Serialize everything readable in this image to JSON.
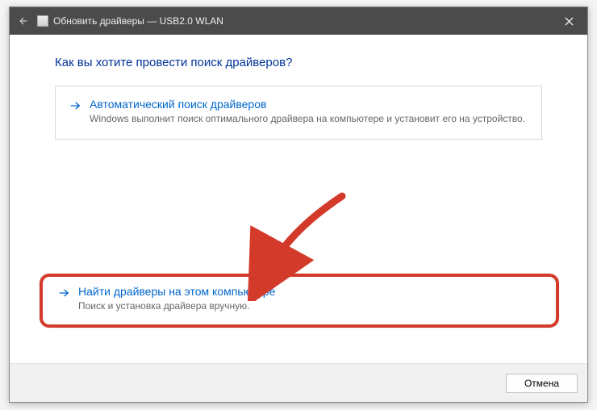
{
  "titlebar": {
    "text": "Обновить драйверы — USB2.0 WLAN"
  },
  "heading": "Как вы хотите провести поиск драйверов?",
  "option_auto": {
    "title": "Автоматический поиск драйверов",
    "desc": "Windows выполнит поиск оптимального драйвера на компьютере и установит его на устройство."
  },
  "option_manual": {
    "title": "Найти драйверы на этом компьютере",
    "desc": "Поиск и установка драйвера вручную."
  },
  "footer": {
    "cancel": "Отмена"
  }
}
